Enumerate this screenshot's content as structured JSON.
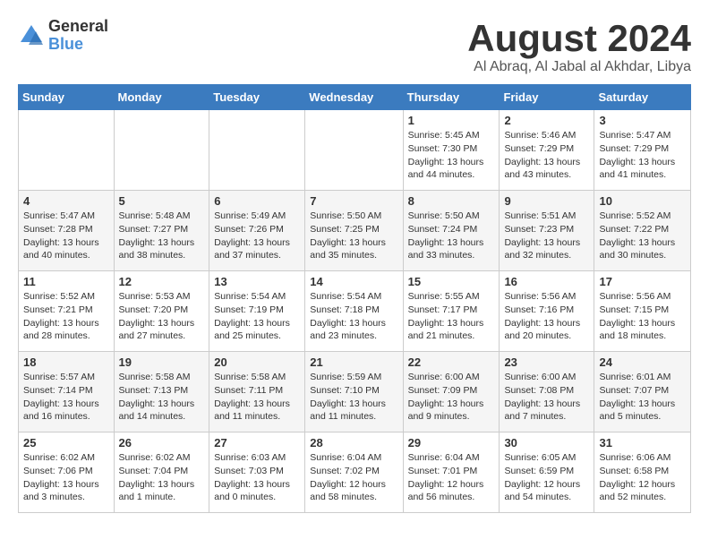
{
  "logo": {
    "general": "General",
    "blue": "Blue"
  },
  "title": "August 2024",
  "location": "Al Abraq, Al Jabal al Akhdar, Libya",
  "days_of_week": [
    "Sunday",
    "Monday",
    "Tuesday",
    "Wednesday",
    "Thursday",
    "Friday",
    "Saturday"
  ],
  "weeks": [
    [
      {
        "day": "",
        "detail": ""
      },
      {
        "day": "",
        "detail": ""
      },
      {
        "day": "",
        "detail": ""
      },
      {
        "day": "",
        "detail": ""
      },
      {
        "day": "1",
        "detail": "Sunrise: 5:45 AM\nSunset: 7:30 PM\nDaylight: 13 hours\nand 44 minutes."
      },
      {
        "day": "2",
        "detail": "Sunrise: 5:46 AM\nSunset: 7:29 PM\nDaylight: 13 hours\nand 43 minutes."
      },
      {
        "day": "3",
        "detail": "Sunrise: 5:47 AM\nSunset: 7:29 PM\nDaylight: 13 hours\nand 41 minutes."
      }
    ],
    [
      {
        "day": "4",
        "detail": "Sunrise: 5:47 AM\nSunset: 7:28 PM\nDaylight: 13 hours\nand 40 minutes."
      },
      {
        "day": "5",
        "detail": "Sunrise: 5:48 AM\nSunset: 7:27 PM\nDaylight: 13 hours\nand 38 minutes."
      },
      {
        "day": "6",
        "detail": "Sunrise: 5:49 AM\nSunset: 7:26 PM\nDaylight: 13 hours\nand 37 minutes."
      },
      {
        "day": "7",
        "detail": "Sunrise: 5:50 AM\nSunset: 7:25 PM\nDaylight: 13 hours\nand 35 minutes."
      },
      {
        "day": "8",
        "detail": "Sunrise: 5:50 AM\nSunset: 7:24 PM\nDaylight: 13 hours\nand 33 minutes."
      },
      {
        "day": "9",
        "detail": "Sunrise: 5:51 AM\nSunset: 7:23 PM\nDaylight: 13 hours\nand 32 minutes."
      },
      {
        "day": "10",
        "detail": "Sunrise: 5:52 AM\nSunset: 7:22 PM\nDaylight: 13 hours\nand 30 minutes."
      }
    ],
    [
      {
        "day": "11",
        "detail": "Sunrise: 5:52 AM\nSunset: 7:21 PM\nDaylight: 13 hours\nand 28 minutes."
      },
      {
        "day": "12",
        "detail": "Sunrise: 5:53 AM\nSunset: 7:20 PM\nDaylight: 13 hours\nand 27 minutes."
      },
      {
        "day": "13",
        "detail": "Sunrise: 5:54 AM\nSunset: 7:19 PM\nDaylight: 13 hours\nand 25 minutes."
      },
      {
        "day": "14",
        "detail": "Sunrise: 5:54 AM\nSunset: 7:18 PM\nDaylight: 13 hours\nand 23 minutes."
      },
      {
        "day": "15",
        "detail": "Sunrise: 5:55 AM\nSunset: 7:17 PM\nDaylight: 13 hours\nand 21 minutes."
      },
      {
        "day": "16",
        "detail": "Sunrise: 5:56 AM\nSunset: 7:16 PM\nDaylight: 13 hours\nand 20 minutes."
      },
      {
        "day": "17",
        "detail": "Sunrise: 5:56 AM\nSunset: 7:15 PM\nDaylight: 13 hours\nand 18 minutes."
      }
    ],
    [
      {
        "day": "18",
        "detail": "Sunrise: 5:57 AM\nSunset: 7:14 PM\nDaylight: 13 hours\nand 16 minutes."
      },
      {
        "day": "19",
        "detail": "Sunrise: 5:58 AM\nSunset: 7:13 PM\nDaylight: 13 hours\nand 14 minutes."
      },
      {
        "day": "20",
        "detail": "Sunrise: 5:58 AM\nSunset: 7:11 PM\nDaylight: 13 hours\nand 11 minutes."
      },
      {
        "day": "21",
        "detail": "Sunrise: 5:59 AM\nSunset: 7:10 PM\nDaylight: 13 hours\nand 11 minutes."
      },
      {
        "day": "22",
        "detail": "Sunrise: 6:00 AM\nSunset: 7:09 PM\nDaylight: 13 hours\nand 9 minutes."
      },
      {
        "day": "23",
        "detail": "Sunrise: 6:00 AM\nSunset: 7:08 PM\nDaylight: 13 hours\nand 7 minutes."
      },
      {
        "day": "24",
        "detail": "Sunrise: 6:01 AM\nSunset: 7:07 PM\nDaylight: 13 hours\nand 5 minutes."
      }
    ],
    [
      {
        "day": "25",
        "detail": "Sunrise: 6:02 AM\nSunset: 7:06 PM\nDaylight: 13 hours\nand 3 minutes."
      },
      {
        "day": "26",
        "detail": "Sunrise: 6:02 AM\nSunset: 7:04 PM\nDaylight: 13 hours\nand 1 minute."
      },
      {
        "day": "27",
        "detail": "Sunrise: 6:03 AM\nSunset: 7:03 PM\nDaylight: 13 hours\nand 0 minutes."
      },
      {
        "day": "28",
        "detail": "Sunrise: 6:04 AM\nSunset: 7:02 PM\nDaylight: 12 hours\nand 58 minutes."
      },
      {
        "day": "29",
        "detail": "Sunrise: 6:04 AM\nSunset: 7:01 PM\nDaylight: 12 hours\nand 56 minutes."
      },
      {
        "day": "30",
        "detail": "Sunrise: 6:05 AM\nSunset: 6:59 PM\nDaylight: 12 hours\nand 54 minutes."
      },
      {
        "day": "31",
        "detail": "Sunrise: 6:06 AM\nSunset: 6:58 PM\nDaylight: 12 hours\nand 52 minutes."
      }
    ]
  ]
}
